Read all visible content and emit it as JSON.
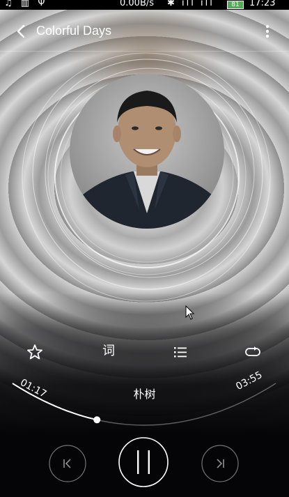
{
  "status_bar": {
    "left_icons": "♫ ▥ Ψ",
    "speed": "0.00B/s",
    "right_icons": "✱ ıll ıll ",
    "battery": "81",
    "time": "17:23"
  },
  "header": {
    "title": "Colorful Days"
  },
  "player": {
    "song_title": "朴树",
    "elapsed": "01:17",
    "duration": "03:55",
    "progress": 0.33
  },
  "actions": {
    "lyrics_label": "词"
  },
  "colors": {
    "accent": "#ffffff",
    "background": "#050507"
  },
  "icons": [
    "back-arrow-icon",
    "more-vertical-icon",
    "star-icon",
    "lyrics-icon",
    "playlist-icon",
    "repeat-icon",
    "previous-icon",
    "pause-icon",
    "next-icon",
    "cursor-icon"
  ]
}
